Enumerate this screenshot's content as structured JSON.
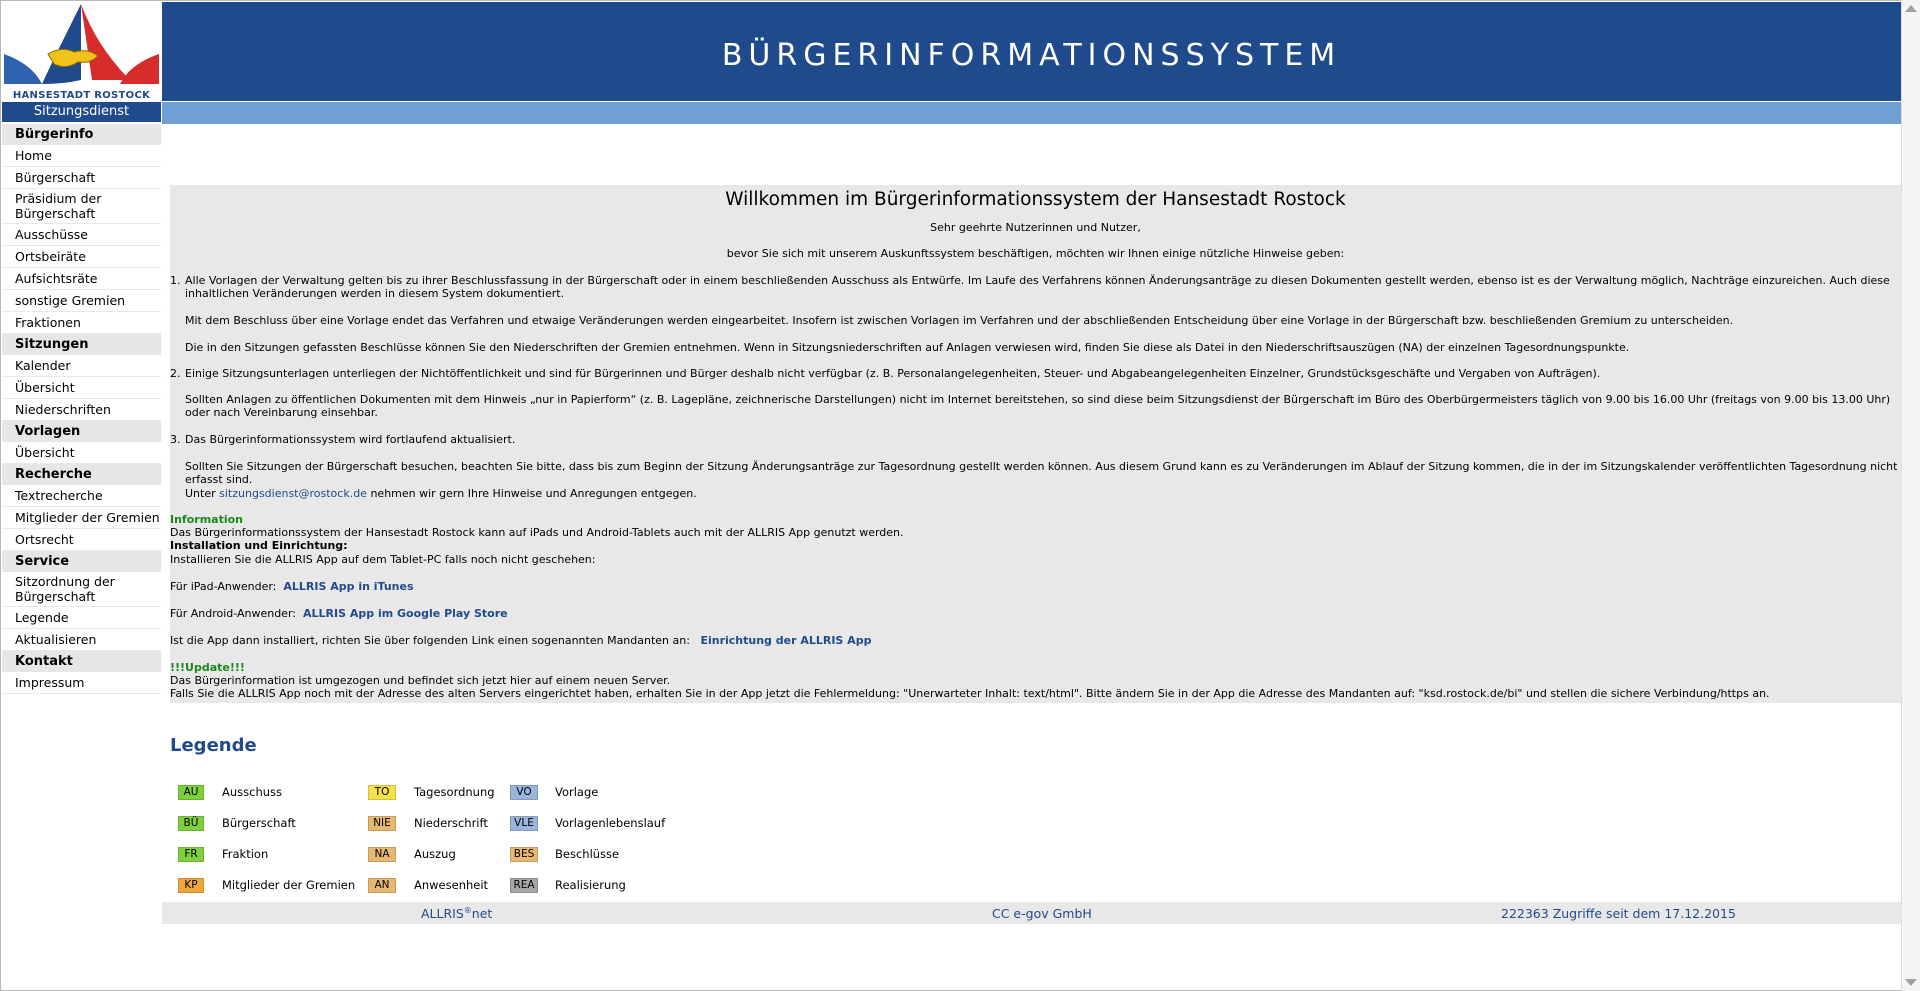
{
  "logo": {
    "text": "HANSESTADT ROSTOCK",
    "subtitle": "Sitzungsdienst"
  },
  "header": {
    "title": "BÜRGERINFORMATIONSSYSTEM"
  },
  "sidebar": {
    "sections": [
      {
        "heading": "Bürgerinfo",
        "items": [
          "Home",
          "Bürgerschaft",
          "Präsidium der Bürgerschaft",
          "Ausschüsse",
          "Ortsbeiräte",
          "Aufsichtsräte",
          "sonstige Gremien",
          "Fraktionen"
        ]
      },
      {
        "heading": "Sitzungen",
        "items": [
          "Kalender",
          "Übersicht",
          "Niederschriften"
        ]
      },
      {
        "heading": "Vorlagen",
        "items": [
          "Übersicht"
        ]
      },
      {
        "heading": "Recherche",
        "items": [
          "Textrecherche",
          "Mitglieder der Gremien",
          "Ortsrecht"
        ]
      },
      {
        "heading": "Service",
        "items": [
          "Sitzordnung der Bürgerschaft",
          "Legende",
          "Aktualisieren"
        ]
      },
      {
        "heading": "Kontakt",
        "items": [
          "Impressum"
        ]
      }
    ]
  },
  "welcome": {
    "title": "Willkommen im Bürgerinformationssystem der Hansestadt Rostock",
    "greeting": "Sehr geehrte Nutzerinnen und Nutzer,",
    "intro": "bevor Sie sich mit unserem Auskunftssystem beschäftigen, möchten wir Ihnen einige nützliche Hinweise geben:",
    "n1": "1.",
    "p1a": "Alle Vorlagen der Verwaltung gelten bis zu ihrer Beschlussfassung in der Bürgerschaft oder in einem beschließenden Ausschuss als Entwürfe. Im Laufe des Verfahrens können Änderungsanträge zu diesen Dokumenten gestellt werden, ebenso ist es der Verwaltung möglich, Nachträge einzureichen. Auch diese inhaltlichen Veränderungen werden in diesem System dokumentiert.",
    "p1b": "Mit dem Beschluss über eine Vorlage endet das Verfahren und etwaige Veränderungen werden eingearbeitet. Insofern ist zwischen Vorlagen im Verfahren und der abschließenden Entscheidung über eine Vorlage in der Bürgerschaft bzw. beschließenden Gremium zu unterscheiden.",
    "p1c": "Die in den Sitzungen gefassten Beschlüsse können Sie den Niederschriften der Gremien entnehmen. Wenn in Sitzungsniederschriften auf Anlagen verwiesen wird, finden Sie diese als Datei in den Niederschriftsauszügen (NA) der einzelnen Tagesordnungspunkte.",
    "n2": "2.",
    "p2a": "Einige Sitzungsunterlagen unterliegen der Nichtöffentlichkeit und sind für Bürgerinnen und Bürger deshalb nicht verfügbar (z. B. Personalangelegenheiten, Steuer- und Abgabeangelegenheiten Einzelner, Grundstücksgeschäfte und Vergaben von Aufträgen).",
    "p2b": "Sollten Anlagen zu öffentlichen Dokumenten mit dem Hinweis „nur in Papierform“ (z. B. Lagepläne, zeichnerische Darstellungen) nicht im Internet bereitstehen, so sind diese beim Sitzungsdienst der Bürgerschaft im Büro des Oberbürgermeisters täglich von 9.00 bis 16.00 Uhr (freitags von 9.00 bis 13.00 Uhr) oder nach Vereinbarung einsehbar.",
    "n3": "3.",
    "p3a": "Das Bürgerinformationssystem wird fortlaufend aktualisiert.",
    "p3b": "Sollten Sie Sitzungen der Bürgerschaft besuchen, beachten Sie bitte, dass bis zum Beginn der Sitzung Änderungsanträge zur Tagesordnung gestellt werden können. Aus diesem Grund kann es zu Veränderungen im Ablauf der Sitzung kommen, die in der im Sitzungskalender veröffentlichten Tagesordnung nicht erfasst sind.",
    "p3c_pre": "Unter",
    "p3c_link": "sitzungsdienst@rostock.de",
    "p3c_post": "nehmen wir gern Ihre Hinweise und Anregungen entgegen.",
    "info_heading": "Information",
    "info_text": "Das Bürgerinformationssystem der Hansestadt Rostock kann auf iPads und Android-Tablets auch mit der ALLRIS App genutzt werden.",
    "install_heading": "Installation und Einrichtung:",
    "install_text": "Installieren Sie die ALLRIS App auf dem Tablet-PC falls noch nicht geschehen:",
    "ipad_label": "Für iPad-Anwender:",
    "ipad_link": "ALLRIS App in iTunes",
    "android_label": "Für Android-Anwender:",
    "android_link": "ALLRIS App im Google Play Store",
    "mandant_label": "Ist die App dann installiert, richten Sie über folgenden Link einen sogenannten Mandanten an:",
    "mandant_link": "Einrichtung der ALLRIS App",
    "update_heading": "!!!Update!!!",
    "update_text1": "Das Bürgerinformation ist umgezogen und befindet sich jetzt hier auf einem neuen Server.",
    "update_text2": "Falls Sie die ALLRIS App noch mit der Adresse des alten Servers eingerichtet haben, erhalten Sie in der App jetzt die Fehlermeldung: \"Unerwarteter Inhalt: text/html\". Bitte ändern Sie in der App die Adresse des Mandanten auf: \"ksd.rostock.de/bi\" und stellen die sichere Verbindung/https an."
  },
  "legend": {
    "title": "Legende",
    "items": [
      {
        "code": "AU",
        "label": "Ausschuss",
        "color": "#7ed13b"
      },
      {
        "code": "BÜ",
        "label": "Bürgerschaft",
        "color": "#7ed13b"
      },
      {
        "code": "FR",
        "label": "Fraktion",
        "color": "#7ed13b"
      },
      {
        "code": "KP",
        "label": "Mitglieder der Gremien",
        "color": "#f0a63c"
      },
      {
        "code": "TO",
        "label": "Tagesordnung",
        "color": "#f6e14a"
      },
      {
        "code": "NIE",
        "label": "Niederschrift",
        "color": "#e8b873"
      },
      {
        "code": "NA",
        "label": "Auszug",
        "color": "#e8b873"
      },
      {
        "code": "AN",
        "label": "Anwesenheit",
        "color": "#e8b873"
      },
      {
        "code": "VO",
        "label": "Vorlage",
        "color": "#9ab4db"
      },
      {
        "code": "VLE",
        "label": "Vorlagenlebenslauf",
        "color": "#9ab4db"
      },
      {
        "code": "BES",
        "label": "Beschlüsse",
        "color": "#e8b873"
      },
      {
        "code": "REA",
        "label": "Realisierung",
        "color": "#a6a6a6"
      }
    ]
  },
  "footer": {
    "brand": "ALLRIS",
    "brand_sup": "®",
    "brand_suffix": "net",
    "company": "CC e-gov GmbH",
    "counter": "222363 Zugriffe seit dem 17.12.2015"
  }
}
